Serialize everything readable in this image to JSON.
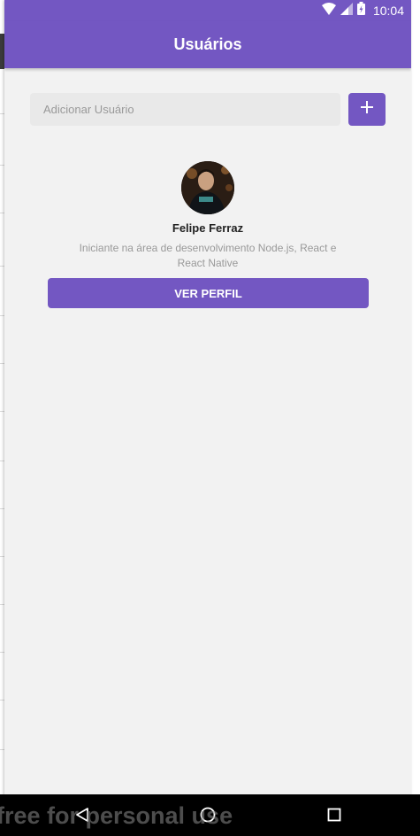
{
  "status_bar": {
    "time": "10:04",
    "icons": [
      "wifi-icon",
      "signal-icon",
      "battery-icon"
    ]
  },
  "app_bar": {
    "title": "Usuários"
  },
  "add_user": {
    "placeholder": "Adicionar Usuário",
    "value": "",
    "button_icon": "plus-icon"
  },
  "user": {
    "name": "Felipe Ferraz",
    "bio": "Iniciante na área de desenvolvimento Node.js, React e React Native",
    "button_label": "VER PERFIL"
  },
  "nav_bar": {
    "buttons": [
      "back-icon",
      "home-icon",
      "recents-icon"
    ]
  },
  "watermark": {
    "text": "free for personal use"
  },
  "colors": {
    "primary": "#7357c2",
    "background": "#f2f2f2",
    "input_background": "#e9e9e9",
    "muted_text": "#999999"
  }
}
